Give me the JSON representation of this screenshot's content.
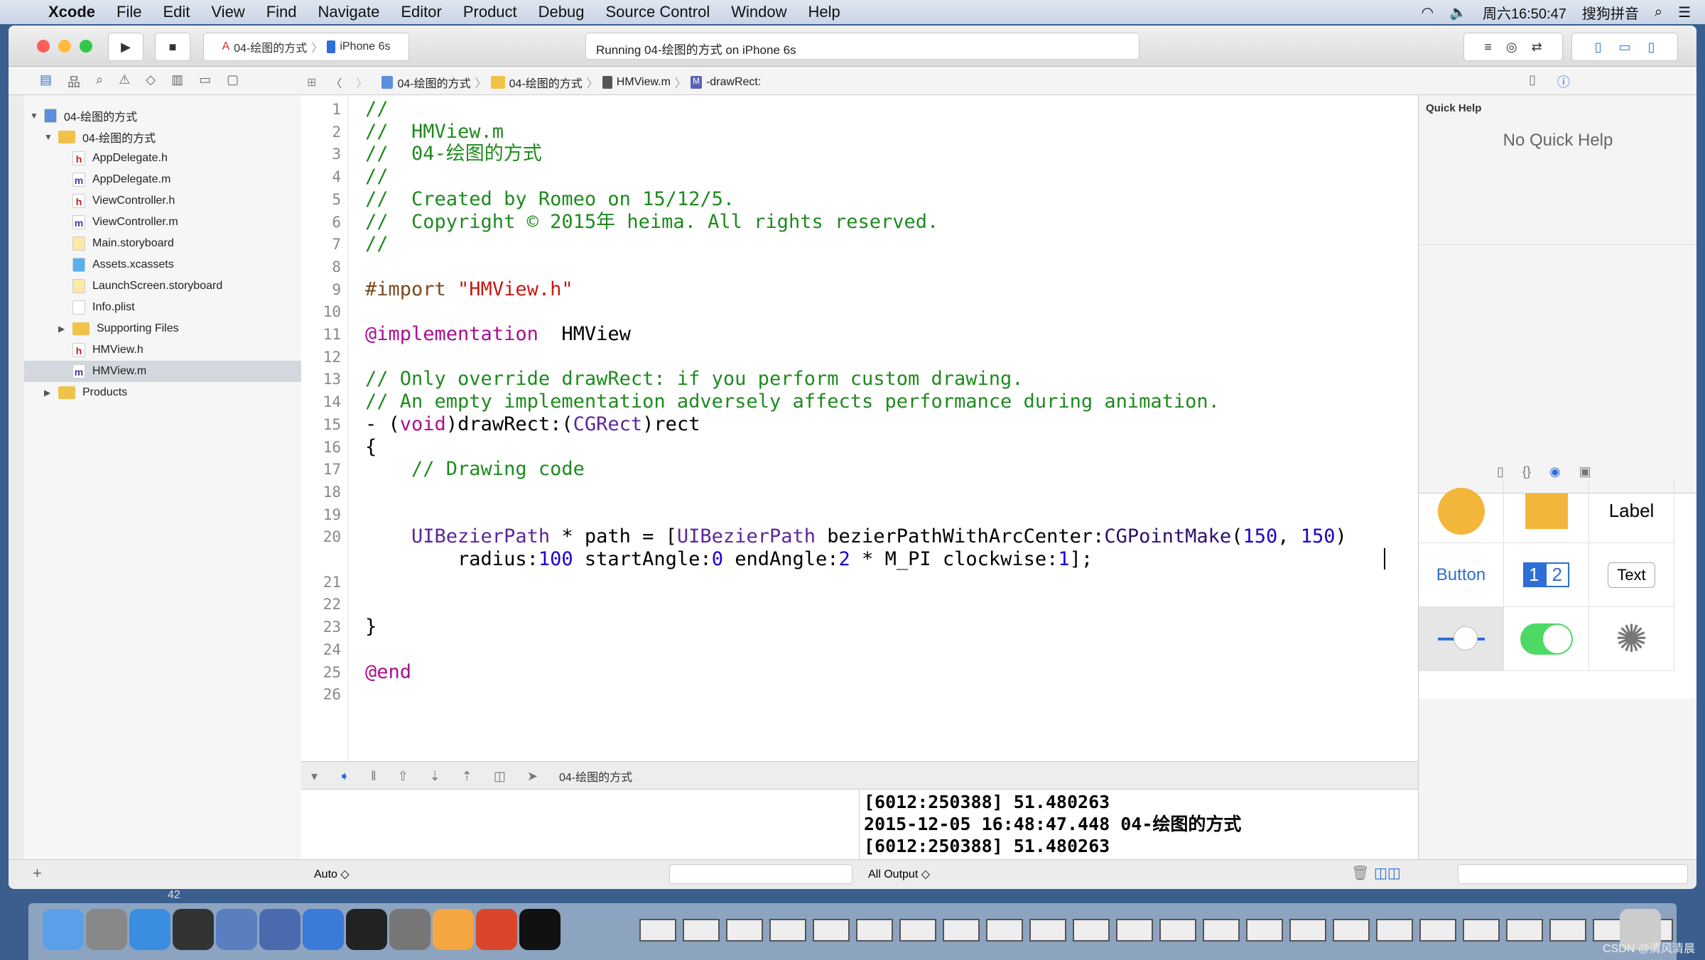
{
  "menubar": {
    "app": "Xcode",
    "items": [
      "File",
      "Edit",
      "View",
      "Find",
      "Navigate",
      "Editor",
      "Product",
      "Debug",
      "Source Control",
      "Window",
      "Help"
    ],
    "clock": "周六16:50:47",
    "input_method": "搜狗拼音"
  },
  "toolbar": {
    "scheme": "04-绘图的方式",
    "device": "iPhone 6s",
    "status": "Running 04-绘图的方式 on iPhone 6s"
  },
  "jumpbar": {
    "crumbs": [
      "04-绘图的方式",
      "04-绘图的方式",
      "HMView.m",
      "-drawRect:"
    ]
  },
  "navigator": {
    "items": [
      {
        "label": "04-绘图的方式",
        "type": "project",
        "depth": 0,
        "expanded": true
      },
      {
        "label": "04-绘图的方式",
        "type": "folder",
        "depth": 1,
        "expanded": true
      },
      {
        "label": "AppDelegate.h",
        "type": "h",
        "depth": 2
      },
      {
        "label": "AppDelegate.m",
        "type": "m",
        "depth": 2
      },
      {
        "label": "ViewController.h",
        "type": "h",
        "depth": 2
      },
      {
        "label": "ViewController.m",
        "type": "m",
        "depth": 2
      },
      {
        "label": "Main.storyboard",
        "type": "sb",
        "depth": 2
      },
      {
        "label": "Assets.xcassets",
        "type": "assets",
        "depth": 2
      },
      {
        "label": "LaunchScreen.storyboard",
        "type": "sb",
        "depth": 2
      },
      {
        "label": "Info.plist",
        "type": "plist",
        "depth": 2
      },
      {
        "label": "Supporting Files",
        "type": "folder",
        "depth": 2,
        "expanded": false
      },
      {
        "label": "HMView.h",
        "type": "h",
        "depth": 2
      },
      {
        "label": "HMView.m",
        "type": "m",
        "depth": 2,
        "selected": true
      },
      {
        "label": "Products",
        "type": "folder",
        "depth": 1,
        "expanded": false
      }
    ]
  },
  "editor": {
    "lines": [
      [
        [
          "cm",
          "//"
        ]
      ],
      [
        [
          "cm",
          "//  HMView.m"
        ]
      ],
      [
        [
          "cm",
          "//  04-绘图的方式"
        ]
      ],
      [
        [
          "cm",
          "//"
        ]
      ],
      [
        [
          "cm",
          "//  Created by Romeo on 15/12/5."
        ]
      ],
      [
        [
          "cm",
          "//  Copyright © 2015年 heima. All rights reserved."
        ]
      ],
      [
        [
          "cm",
          "//"
        ]
      ],
      [],
      [
        [
          "pp",
          "#import "
        ],
        [
          "st",
          "\"HMView.h\""
        ]
      ],
      [],
      [
        [
          "kw",
          "@implementation"
        ],
        [
          "",
          "  HMView"
        ]
      ],
      [],
      [
        [
          "cm",
          "// Only override drawRect: if you perform custom drawing."
        ]
      ],
      [
        [
          "cm",
          "// An empty implementation adversely affects performance during animation."
        ]
      ],
      [
        [
          "",
          "- ("
        ],
        [
          "kw",
          "void"
        ],
        [
          "",
          ")drawRect:("
        ],
        [
          "ty",
          "CGRect"
        ],
        [
          "",
          ")rect"
        ]
      ],
      [
        [
          "",
          "{"
        ]
      ],
      [
        [
          "cm",
          "    // Drawing code"
        ]
      ],
      [],
      [],
      [
        [
          "ty",
          "    UIBezierPath"
        ],
        [
          "",
          " * path = ["
        ],
        [
          "ty",
          "UIBezierPath"
        ],
        [
          "",
          " bezierPathWithArcCenter:"
        ],
        [
          "fn",
          "CGPointMake"
        ],
        [
          "",
          "("
        ],
        [
          "nu",
          "150"
        ],
        [
          "",
          ", "
        ],
        [
          "nu",
          "150"
        ],
        [
          "",
          ")"
        ],
        [
          "\n",
          ""
        ],
        [
          "",
          "        radius:"
        ],
        [
          "nu",
          "100"
        ],
        [
          "",
          " startAngle:"
        ],
        [
          "nu",
          "0"
        ],
        [
          "",
          " endAngle:"
        ],
        [
          "nu",
          "2"
        ],
        [
          "",
          " * M_PI clockwise:"
        ],
        [
          "nu",
          "1"
        ],
        [
          "",
          "];"
        ]
      ],
      [],
      [],
      [
        [
          "",
          "}"
        ]
      ],
      [],
      [
        [
          "kw",
          "@end"
        ]
      ],
      []
    ]
  },
  "debug": {
    "process": "04-绘图的方式",
    "variables_scope": "Auto ◇",
    "output_scope": "All Output ◇",
    "console": [
      "[6012:250388] 51.480263",
      "2015-12-05 16:48:47.448 04-绘图的方式",
      "[6012:250388] 51.480263"
    ]
  },
  "inspector": {
    "title": "Quick Help",
    "empty": "No Quick Help",
    "library": {
      "label": "Label",
      "button": "Button",
      "seg1": "1",
      "seg2": "2",
      "text": "Text"
    }
  },
  "bottom": {
    "page": "42"
  },
  "watermark": "CSDN @清风清晨"
}
